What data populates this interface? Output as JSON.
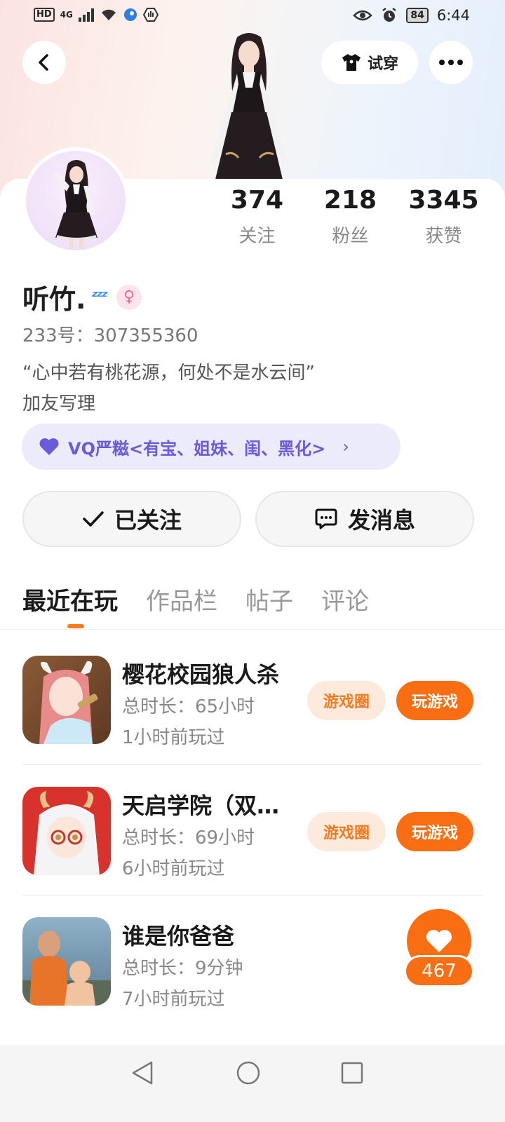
{
  "status_bar": {
    "hd": "HD",
    "network": "4G",
    "battery": "84",
    "time": "6:44"
  },
  "header": {
    "tryon_label": "试穿"
  },
  "stats": [
    {
      "num": "374",
      "label": "关注"
    },
    {
      "num": "218",
      "label": "粉丝"
    },
    {
      "num": "3345",
      "label": "获赞"
    }
  ],
  "profile": {
    "name": "听竹.",
    "zzz": "ᶻᶻᶻ",
    "gender_symbol": "♀",
    "uid": "233号：307355360",
    "bio_line1": "“心中若有桃花源，何处不是水云间”",
    "bio_line2": "加友写理",
    "club_label": "VQ严糍<有宝、姐妹、闺、黑化>",
    "club_chevron": "›"
  },
  "actions": {
    "follow_label": "已关注",
    "message_label": "发消息"
  },
  "tabs": [
    "最近在玩",
    "作品栏",
    "帖子",
    "评论"
  ],
  "games": [
    {
      "title": "樱花校园狼人杀",
      "duration": "总时长：65小时",
      "last_played": "1小时前玩过",
      "circle_label": "游戏圈",
      "play_label": "玩游戏"
    },
    {
      "title": "天启学院（双…",
      "duration": "总时长：69小时",
      "last_played": "6小时前玩过",
      "circle_label": "游戏圈",
      "play_label": "玩游戏"
    },
    {
      "title": "谁是你爸爸",
      "duration": "总时长：9分钟",
      "last_played": "7小时前玩过"
    }
  ],
  "like": {
    "count": "467"
  },
  "colors": {
    "accent_orange": "#f96e12",
    "club_purple": "#6b5ad9"
  }
}
